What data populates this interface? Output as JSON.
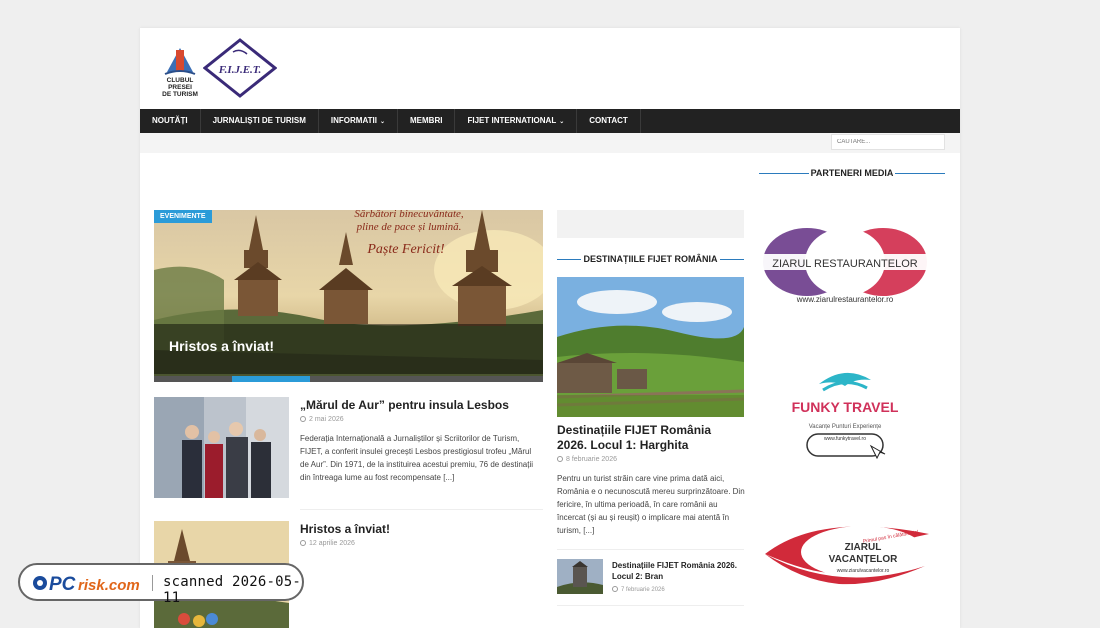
{
  "nav": {
    "items": [
      {
        "label": "NOUTĂȚI",
        "has_dropdown": false
      },
      {
        "label": "JURNALIȘTI DE TURISM",
        "has_dropdown": false
      },
      {
        "label": "INFORMATII",
        "has_dropdown": true
      },
      {
        "label": "MEMBRI",
        "has_dropdown": false
      },
      {
        "label": "FIJET INTERNATIONAL",
        "has_dropdown": true
      },
      {
        "label": "CONTACT",
        "has_dropdown": false
      }
    ]
  },
  "search": {
    "placeholder": "CAUTARE..."
  },
  "logos": {
    "club_text": [
      "CLUBUL",
      "PRESEI",
      "DE TURISM"
    ],
    "fijet_text": "F.I.J.E.T."
  },
  "slider": {
    "category": "EVENIMENTE",
    "title": "Hristos a înviat!",
    "banner_line1": "Sărbători binecuvântate,",
    "banner_line2": "pline de pace și lumină.",
    "banner_line3": "Paște Fericit!",
    "active_slide": 2,
    "total_slides": 5
  },
  "posts": [
    {
      "title": "„Mărul de Aur” pentru insula Lesbos",
      "date": "2 mai 2026",
      "excerpt": "Federația Internațională a Jurnaliștilor și Scriitorilor de Turism, FIJET, a conferit insulei grecești Lesbos prestigiosul trofeu „Mărul de Aur”. Din 1971, de la instituirea acestui premiu, 76 de destinații din întreaga lume au fost recompensate [...]"
    },
    {
      "title": "Hristos a înviat!",
      "date": "12 aprilie 2026"
    }
  ],
  "destinations": {
    "heading": "DESTINAȚIILE FIJET ROMÂNIA",
    "featured": {
      "title": "Destinațiile FIJET România 2026. Locul 1: Harghita",
      "date": "8 februarie 2026",
      "excerpt": "Pentru un turist străin care vine prima dată aici, România e o necunoscută mereu surprinzătoare. Din fericire, în ultima perioadă, în care românii au încercat (și au și reușit) o implicare mai atentă în turism, [...]"
    },
    "small": {
      "title": "Destinațiile FIJET România 2026. Locul 2: Bran",
      "date": "7 februarie 2026"
    }
  },
  "sidebar": {
    "heading": "PARTENERI MEDIA",
    "ads": [
      {
        "name": "ZIARUL RESTAURANTELOR",
        "url": "www.ziarulrestaurantelor.ro"
      },
      {
        "name": "FUNKY TRAVEL",
        "tagline": "Vacanțe Punturi Experiențe",
        "url": "www.funkytravel.ro"
      },
      {
        "name_line1": "ZIARUL",
        "name_line2": "VACANȚELOR",
        "tagline": "Primul pas în călătoria ta!",
        "url": "www.ziarulvacantelor.ro"
      }
    ]
  },
  "watermark": {
    "brand": "PCrisk.com",
    "text": "scanned 2026-05-11"
  },
  "colors": {
    "accent": "#2b9bd8",
    "nav_bg": "#222222",
    "sidebar_line": "#2b7bbd"
  }
}
